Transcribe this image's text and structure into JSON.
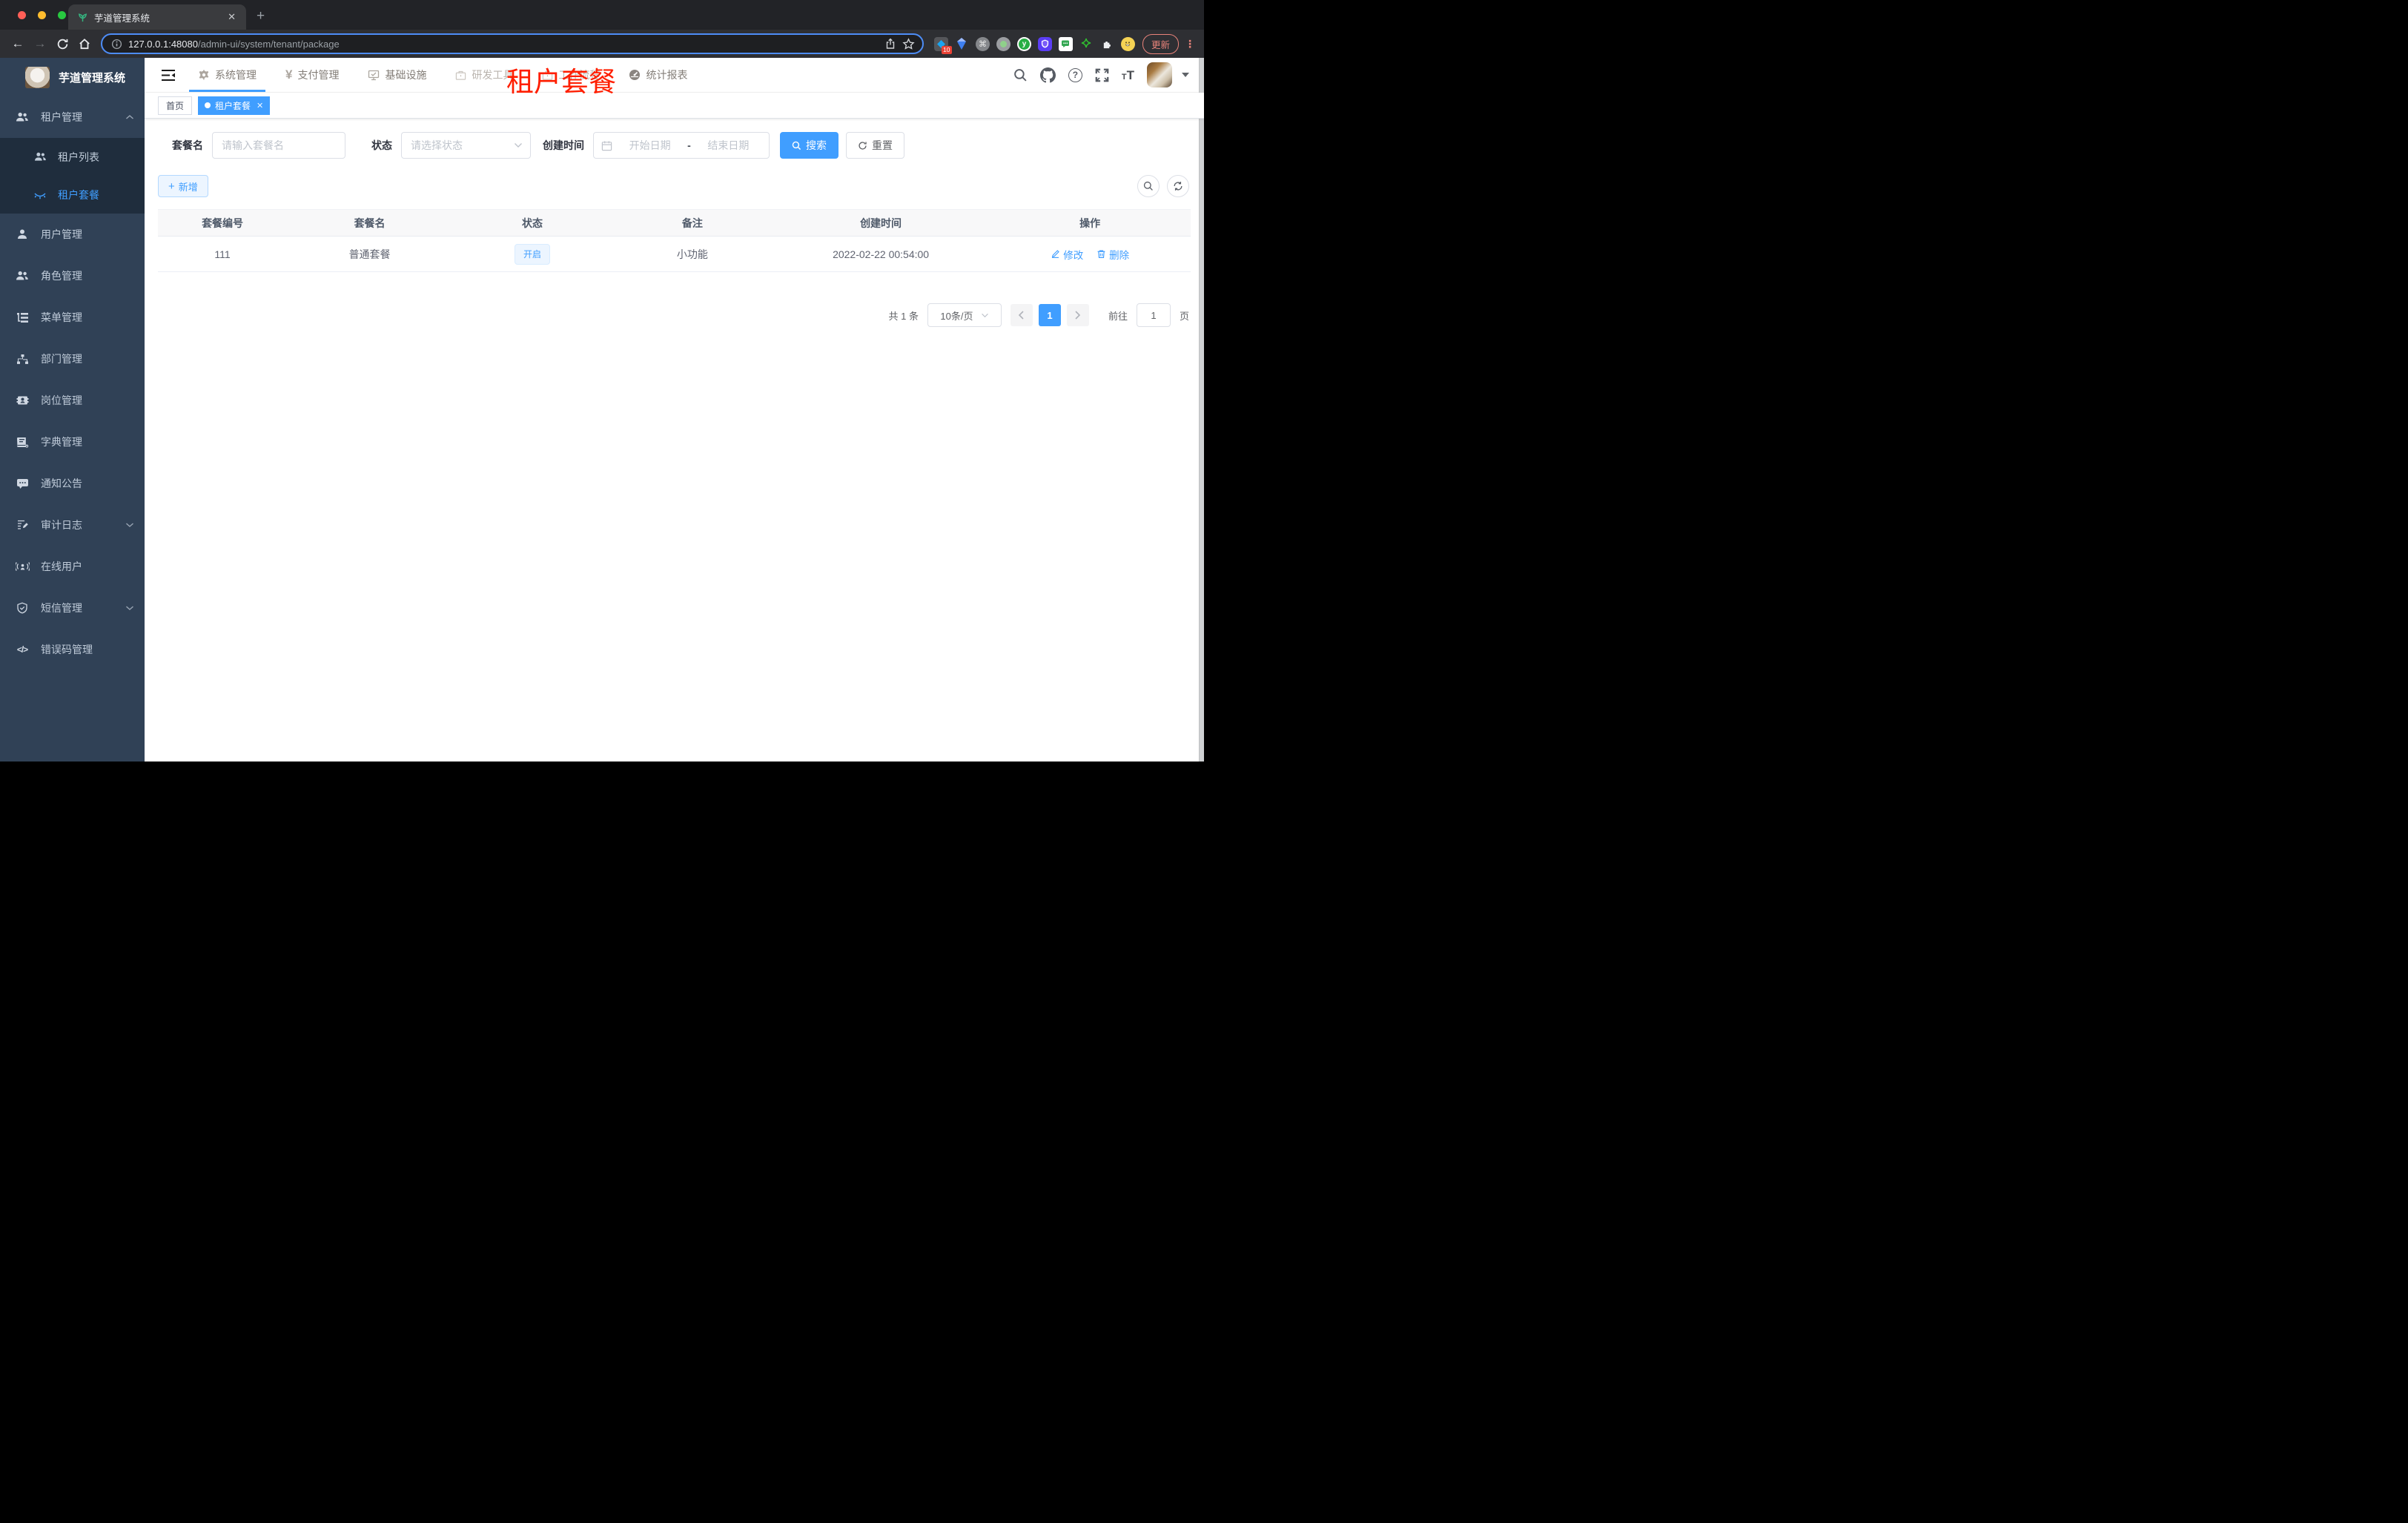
{
  "colors": {
    "accent": "#409eff",
    "watermark_red": "#ff1e00",
    "sidebar_bg": "#304156",
    "submenu_bg": "#1f2d3d"
  },
  "browser": {
    "tab_title": "芋道管理系统",
    "url_host": "127.0.0.1:48080",
    "url_path": "/admin-ui/system/tenant/package",
    "ext_badge": "10",
    "ext_y_label": "y",
    "update_label": "更新"
  },
  "sidebar": {
    "logo_title": "芋道管理系统",
    "items": [
      {
        "label": "租户管理"
      },
      {
        "label": "租户列表"
      },
      {
        "label": "租户套餐"
      },
      {
        "label": "用户管理"
      },
      {
        "label": "角色管理"
      },
      {
        "label": "菜单管理"
      },
      {
        "label": "部门管理"
      },
      {
        "label": "岗位管理"
      },
      {
        "label": "字典管理"
      },
      {
        "label": "通知公告"
      },
      {
        "label": "审计日志"
      },
      {
        "label": "在线用户"
      },
      {
        "label": "短信管理"
      },
      {
        "label": "错误码管理"
      }
    ]
  },
  "topnav": {
    "items": [
      {
        "label": "系统管理"
      },
      {
        "label": "支付管理"
      },
      {
        "label": "基础设施"
      },
      {
        "label": "研发工具"
      },
      {
        "label": "工作流程"
      },
      {
        "label": "统计报表"
      }
    ]
  },
  "tags": {
    "home": "首页",
    "active": "租户套餐"
  },
  "watermark": "租户套餐",
  "filters": {
    "name_label": "套餐名",
    "name_placeholder": "请输入套餐名",
    "status_label": "状态",
    "status_placeholder": "请选择状态",
    "date_label": "创建时间",
    "date_start": "开始日期",
    "date_separator": "-",
    "date_end": "结束日期",
    "search_label": "搜索",
    "reset_label": "重置"
  },
  "toolbar": {
    "add_label": "新增"
  },
  "table": {
    "headers": [
      "套餐编号",
      "套餐名",
      "状态",
      "备注",
      "创建时间",
      "操作"
    ],
    "rows": [
      {
        "id": "111",
        "name": "普通套餐",
        "status": "开启",
        "remark": "小功能",
        "created_at": "2022-02-22 00:54:00",
        "edit_label": "修改",
        "delete_label": "删除"
      }
    ]
  },
  "pagination": {
    "total": "共 1 条",
    "page_size": "10条/页",
    "current_page": "1",
    "goto_label": "前往",
    "goto_value": "1",
    "unit_label": "页"
  }
}
